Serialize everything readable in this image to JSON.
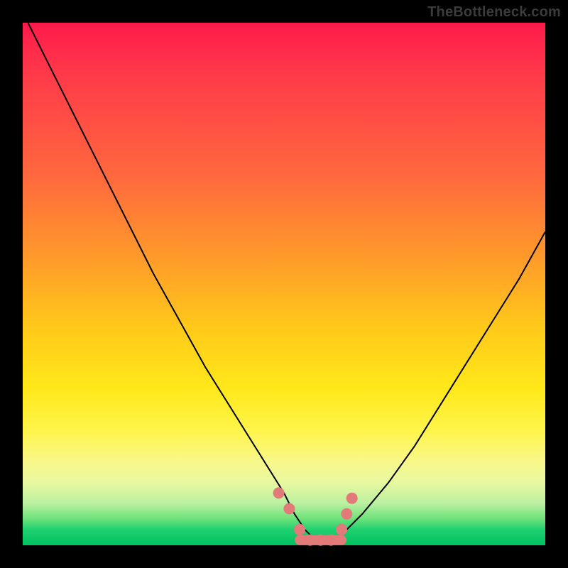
{
  "watermark": "TheBottleneck.com",
  "colors": {
    "frame": "#000000",
    "curve": "#000000",
    "marker": "#e37a7a",
    "gradient_stops": [
      "#ff1a4a",
      "#ff3a4a",
      "#ff6a3d",
      "#ff9a2a",
      "#ffc81a",
      "#ffe81a",
      "#fff44a",
      "#f8f88a",
      "#e8f8a0",
      "#baf0a0",
      "#6be27a",
      "#20d070",
      "#00c060"
    ]
  },
  "chart_data": {
    "type": "line",
    "title": "",
    "xlabel": "",
    "ylabel": "",
    "xlim": [
      0,
      100
    ],
    "ylim": [
      0,
      100
    ],
    "series": [
      {
        "name": "bottleneck-curve",
        "x": [
          1,
          5,
          10,
          15,
          20,
          25,
          30,
          35,
          40,
          45,
          50,
          52,
          54,
          56,
          58,
          60,
          62,
          65,
          70,
          75,
          80,
          85,
          90,
          95,
          100
        ],
        "y": [
          100,
          92,
          82,
          72,
          62,
          52,
          43,
          34,
          26,
          18,
          10,
          6,
          3,
          1,
          1,
          1,
          3,
          6,
          12,
          19,
          27,
          35,
          43,
          51,
          60
        ]
      }
    ],
    "markers": {
      "name": "highlight-points",
      "x": [
        49,
        51,
        53,
        55,
        57,
        59,
        61,
        62,
        63
      ],
      "y": [
        10,
        7,
        3,
        1,
        1,
        1,
        3,
        6,
        9
      ]
    },
    "floor_segment": {
      "x_start": 53,
      "x_end": 61,
      "y": 1
    }
  }
}
